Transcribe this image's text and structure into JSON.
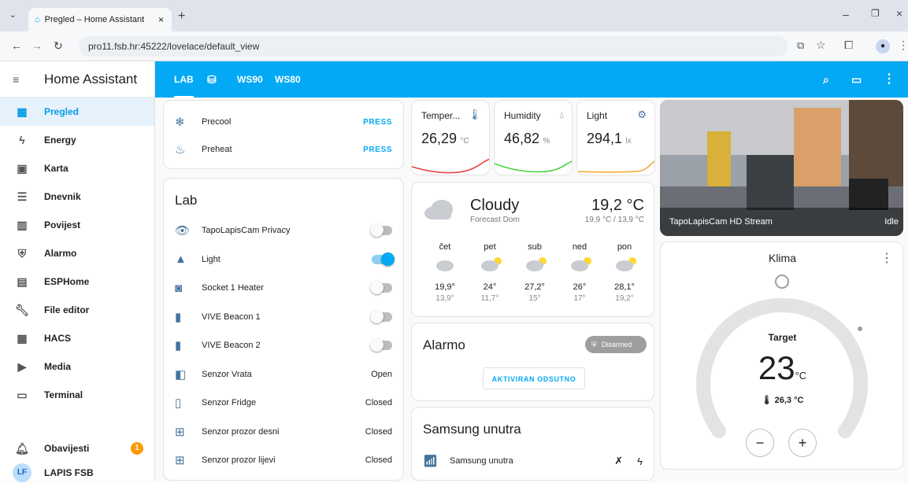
{
  "browser": {
    "tab_title": "Pregled – Home Assistant",
    "url": "pro11.fsb.hr:45222/lovelace/default_view"
  },
  "sidebar": {
    "title": "Home Assistant",
    "items": [
      {
        "label": "Pregled",
        "icon": "dashboard-icon"
      },
      {
        "label": "Energy",
        "icon": "lightning-icon"
      },
      {
        "label": "Karta",
        "icon": "map-icon"
      },
      {
        "label": "Dnevnik",
        "icon": "list-icon"
      },
      {
        "label": "Povijest",
        "icon": "chart-icon"
      },
      {
        "label": "Alarmo",
        "icon": "shield-icon"
      },
      {
        "label": "ESPHome",
        "icon": "chip-icon"
      },
      {
        "label": "File editor",
        "icon": "wrench-icon"
      },
      {
        "label": "HACS",
        "icon": "store-icon"
      },
      {
        "label": "Media",
        "icon": "play-icon"
      },
      {
        "label": "Terminal",
        "icon": "terminal-icon"
      }
    ],
    "notifications_label": "Obavijesti",
    "notifications_count": "1",
    "user_initials": "LF",
    "user_name": "LAPIS FSB"
  },
  "topbar": {
    "tabs": [
      "LAB",
      "WS90",
      "WS80"
    ]
  },
  "buttons_card": {
    "rows": [
      {
        "name": "Precool",
        "action": "PRESS"
      },
      {
        "name": "Preheat",
        "action": "PRESS"
      }
    ]
  },
  "lab_card": {
    "title": "Lab",
    "rows": [
      {
        "name": "TapoLapisCam Privacy",
        "state": ""
      },
      {
        "name": "Light",
        "state": ""
      },
      {
        "name": "Socket 1 Heater",
        "state": ""
      },
      {
        "name": "VIVE Beacon 1",
        "state": ""
      },
      {
        "name": "VIVE Beacon 2",
        "state": ""
      },
      {
        "name": "Senzor Vrata",
        "state": "Open"
      },
      {
        "name": "Senzor Fridge",
        "state": "Closed"
      },
      {
        "name": "Senzor prozor desni",
        "state": "Closed"
      },
      {
        "name": "Senzor prozor lijevi",
        "state": "Closed"
      }
    ],
    "toggles": [
      false,
      true,
      false,
      false,
      false
    ]
  },
  "sensors": [
    {
      "name": "Temper...",
      "value": "26,29",
      "unit": "°C",
      "color": "#e53935"
    },
    {
      "name": "Humidity",
      "value": "46,82",
      "unit": "%",
      "color": "#43d33d"
    },
    {
      "name": "Light",
      "value": "294,1",
      "unit": "lx",
      "color": "#f5a623"
    }
  ],
  "weather": {
    "condition": "Cloudy",
    "source": "Forecast Dom",
    "temp": "19,2 °C",
    "hilo": "19,9 °C / 13,9 °C",
    "days": [
      {
        "day": "čet",
        "hi": "19,9°",
        "lo": "13,9°"
      },
      {
        "day": "pet",
        "hi": "24°",
        "lo": "11,7°"
      },
      {
        "day": "sub",
        "hi": "27,2°",
        "lo": "15°"
      },
      {
        "day": "ned",
        "hi": "26°",
        "lo": "17°"
      },
      {
        "day": "pon",
        "hi": "28,1°",
        "lo": "19,2°"
      }
    ]
  },
  "alarmo": {
    "title": "Alarmo",
    "badge": "Disarmed",
    "action": "AKTIVIRAN ODSUTNO"
  },
  "samsung": {
    "title": "Samsung unutra",
    "row_name": "Samsung unutra"
  },
  "camera": {
    "name": "TapoLapisCam HD Stream",
    "state": "Idle"
  },
  "climate": {
    "title": "Klima",
    "target_label": "Target",
    "target": "23",
    "unit": "°C",
    "current": "26,3 °C",
    "minus": "−",
    "plus": "+"
  }
}
